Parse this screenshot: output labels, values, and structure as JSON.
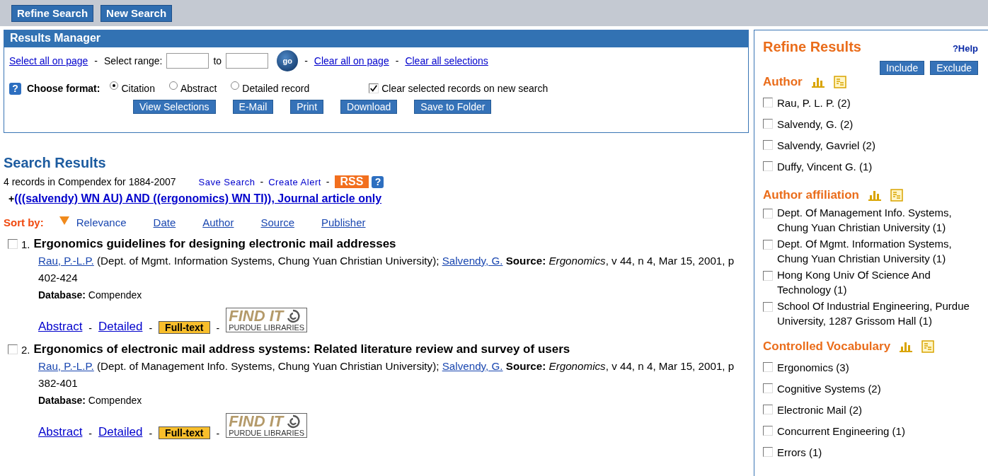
{
  "top_buttons": [
    "Refine Search",
    "New Search"
  ],
  "results_manager": {
    "title": "Results Manager",
    "select_all": "Select all on page",
    "select_range": "Select range:",
    "to": "to",
    "go": "go",
    "clear_page": "Clear all on page",
    "clear_all": "Clear all selections",
    "separator": "-",
    "help_icon": "?",
    "format_label": "Choose format:",
    "formats": [
      {
        "label": "Citation",
        "selected": true
      },
      {
        "label": "Abstract",
        "selected": false
      },
      {
        "label": "Detailed record",
        "selected": false
      }
    ],
    "clear_on_new": {
      "label": "Clear selected records on new search",
      "checked": true
    },
    "actions": [
      "View Selections",
      "E-Mail",
      "Print",
      "Download",
      "Save to Folder"
    ]
  },
  "search_results": {
    "title": "Search Results",
    "summary": "4 records in Compendex for 1884-2007",
    "save_search": "Save Search",
    "create_alert": "Create Alert",
    "separator": "-",
    "rss": "RSS",
    "help_icon": "?",
    "expand": "+",
    "query": "(((salvendy) WN AU) AND ((ergonomics) WN TI)), Journal article only",
    "sort_label": "Sort by:",
    "sort_options": [
      {
        "label": "Relevance",
        "selected": true
      },
      {
        "label": "Date",
        "selected": false
      },
      {
        "label": "Author",
        "selected": false
      },
      {
        "label": "Source",
        "selected": false
      },
      {
        "label": "Publisher",
        "selected": false
      }
    ],
    "records": [
      {
        "number": "1.",
        "checked": false,
        "title": "Ergonomics guidelines for designing electronic mail addresses",
        "authors": [
          {
            "name": "Rau, P.-L.P.",
            "affiliation": "(Dept. of Mgmt. Information Systems, Chung Yuan Christian University);"
          },
          {
            "name": "Salvendy, G."
          }
        ],
        "source": "**Source:** *Ergonomics*, v 44, n 4, Mar 15, 2001, p 402-424",
        "database": "**Database:** Compendex",
        "abstract": "Abstract",
        "detailed": "Detailed",
        "fulltext": "Full-text",
        "findit": {
          "title": "FIND IT",
          "subtitle": "PURDUE LIBRARIES"
        }
      },
      {
        "number": "2.",
        "checked": false,
        "title": "Ergonomics of electronic mail address systems: Related literature review and survey of users",
        "authors": [
          {
            "name": "Rau, P.-L.P.",
            "affiliation": "(Dept. of Management Info. Systems, Chung Yuan Christian University);"
          },
          {
            "name": "Salvendy, G."
          }
        ],
        "source": "**Source:** *Ergonomics*, v 44, n 4, Mar 15, 2001, p 382-401",
        "database": "**Database:** Compendex",
        "abstract": "Abstract",
        "detailed": "Detailed",
        "fulltext": "Full-text",
        "findit": {
          "title": "FIND IT",
          "subtitle": "PURDUE LIBRARIES"
        }
      }
    ]
  },
  "refine": {
    "title": "Refine Results",
    "help": "?Help",
    "include": "Include",
    "exclude": "Exclude",
    "sections": [
      {
        "heading": "Author",
        "items": [
          {
            "label": "Rau, P. L. P. (2)",
            "checked": false
          },
          {
            "label": "Salvendy, G. (2)",
            "checked": false
          },
          {
            "label": "Salvendy, Gavriel (2)",
            "checked": false
          },
          {
            "label": "Duffy, Vincent G. (1)",
            "checked": false
          }
        ]
      },
      {
        "heading": "Author affiliation",
        "items": [
          {
            "label": "Dept. Of Management Info. Systems, Chung Yuan Christian University (1)",
            "checked": false
          },
          {
            "label": "Dept. Of Mgmt. Information Systems, Chung Yuan Christian University (1)",
            "checked": false
          },
          {
            "label": "Hong Kong Univ Of Science And Technology (1)",
            "checked": false
          },
          {
            "label": "School Of Industrial Engineering, Purdue University, 1287 Grissom Hall (1)",
            "checked": false
          }
        ]
      },
      {
        "heading": "Controlled Vocabulary",
        "items": [
          {
            "label": "Ergonomics (3)",
            "checked": false
          },
          {
            "label": "Cognitive Systems (2)",
            "checked": false
          },
          {
            "label": "Electronic Mail (2)",
            "checked": false
          },
          {
            "label": "Concurrent Engineering (1)",
            "checked": false
          },
          {
            "label": "Errors (1)",
            "checked": false
          }
        ]
      }
    ]
  }
}
